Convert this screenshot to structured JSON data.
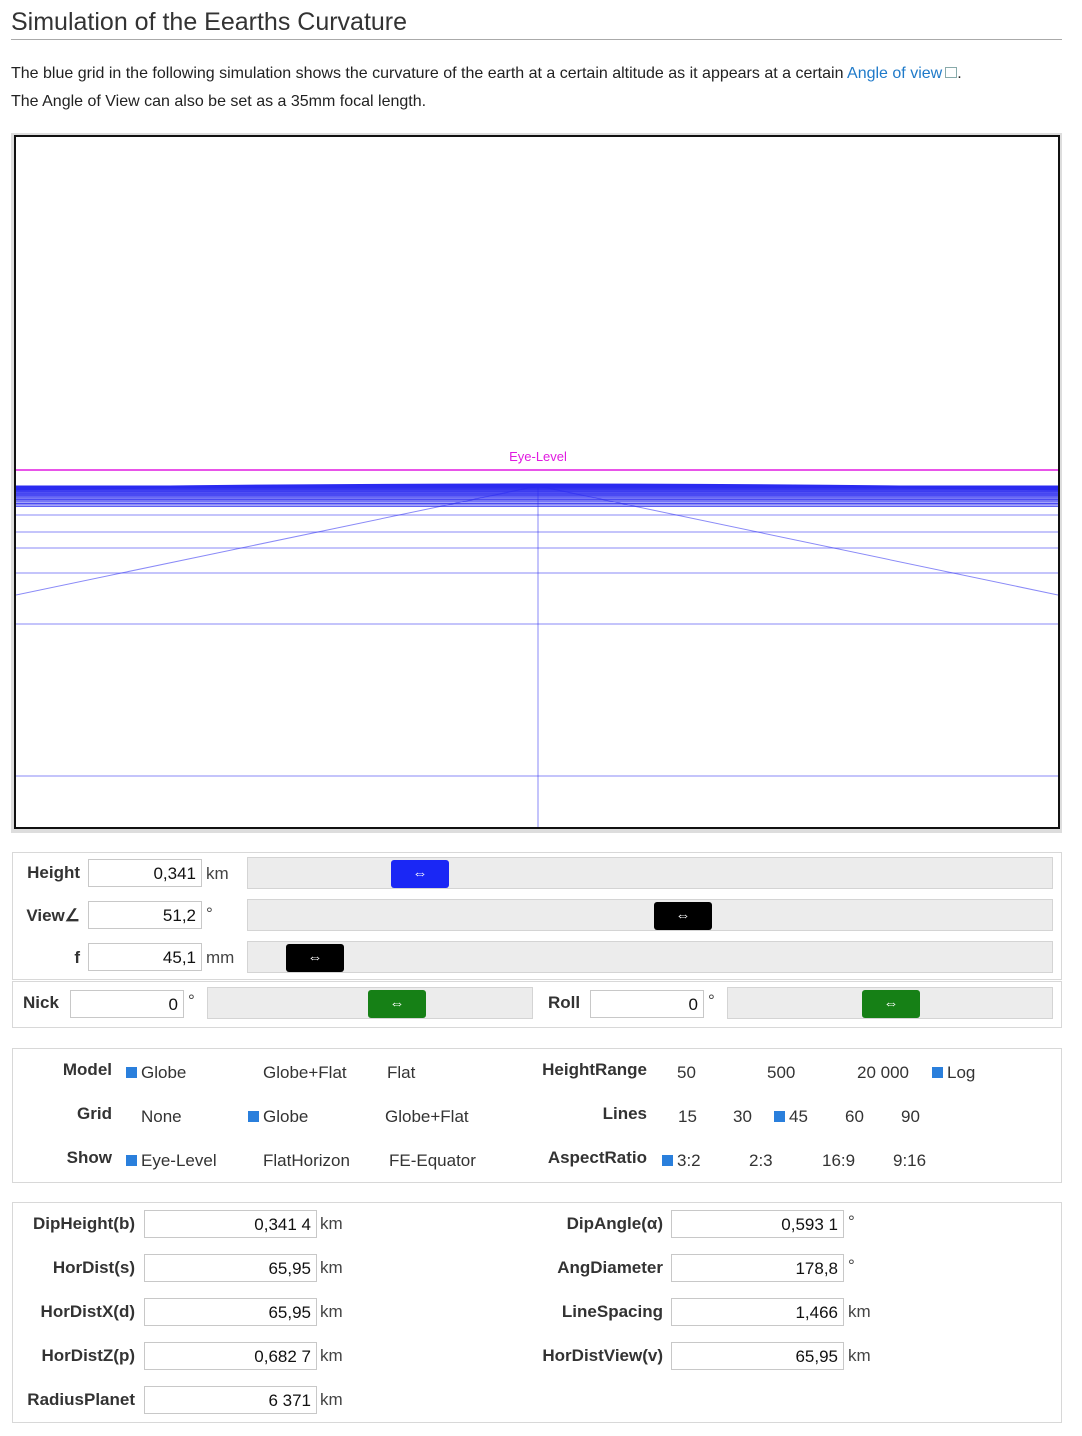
{
  "page": {
    "title": "Simulation of the Eearths Curvature",
    "intro_1": "The blue grid in the following simulation shows the curvature of the earth at a certain altitude as it appears at a certain ",
    "intro_link": "Angle of view",
    "intro_1_end": ".",
    "intro_2": "The Angle of View can also be set as a 35mm focal length."
  },
  "simulation": {
    "eye_level_label": "Eye-Level",
    "eye_level_color": "#e01be0",
    "grid_color": "#2a2af0"
  },
  "controls": {
    "height": {
      "label": "Height",
      "value": "0,341",
      "unit": "km",
      "knob": "⇔",
      "knob_color": "#1a27f5",
      "level": 0.17
    },
    "view": {
      "label": "View∠",
      "value": "51,2",
      "unit": "°",
      "knob": "⇔",
      "knob_color": "#000000",
      "level": 0.52
    },
    "f": {
      "label": "f",
      "value": "45,1",
      "unit": "mm",
      "knob": "⇔",
      "knob_color": "#000000",
      "level": 0.05
    },
    "nick": {
      "label": "Nick",
      "value": "0",
      "unit": "°",
      "knob": "⇔",
      "knob_color": "#168016",
      "level": 0.5
    },
    "roll": {
      "label": "Roll",
      "value": "0",
      "unit": "°",
      "knob": "⇔",
      "knob_color": "#168016",
      "level": 0.5
    }
  },
  "options": {
    "model": {
      "label": "Model",
      "items": [
        {
          "text": "Globe",
          "checked": true
        },
        {
          "text": "Globe+Flat",
          "checked": false
        },
        {
          "text": "Flat",
          "checked": false
        }
      ]
    },
    "grid": {
      "label": "Grid",
      "items": [
        {
          "text": "None",
          "checked": false
        },
        {
          "text": "Globe",
          "checked": true
        },
        {
          "text": "Globe+Flat",
          "checked": false
        }
      ]
    },
    "show": {
      "label": "Show",
      "items": [
        {
          "text": "Eye-Level",
          "checked": true
        },
        {
          "text": "FlatHorizon",
          "checked": false
        },
        {
          "text": "FE-Equator",
          "checked": false
        }
      ]
    },
    "heightrange": {
      "label": "HeightRange",
      "items": [
        {
          "text": "50",
          "checked": false
        },
        {
          "text": "500",
          "checked": false
        },
        {
          "text": "20 000",
          "checked": false
        },
        {
          "text": "Log",
          "checked": true
        }
      ]
    },
    "lines": {
      "label": "Lines",
      "items": [
        {
          "text": "15",
          "checked": false
        },
        {
          "text": "30",
          "checked": false
        },
        {
          "text": "45",
          "checked": true
        },
        {
          "text": "60",
          "checked": false
        },
        {
          "text": "90",
          "checked": false
        }
      ]
    },
    "aspect": {
      "label": "AspectRatio",
      "items": [
        {
          "text": "3:2",
          "checked": true
        },
        {
          "text": "2:3",
          "checked": false
        },
        {
          "text": "16:9",
          "checked": false
        },
        {
          "text": "9:16",
          "checked": false
        }
      ]
    }
  },
  "results": {
    "dip_height": {
      "label": "DipHeight(b)",
      "value": "0,341 4",
      "unit": "km"
    },
    "hor_dist": {
      "label": "HorDist(s)",
      "value": "65,95",
      "unit": "km"
    },
    "hor_dist_x": {
      "label": "HorDistX(d)",
      "value": "65,95",
      "unit": "km"
    },
    "hor_dist_z": {
      "label": "HorDistZ(p)",
      "value": "0,682 7",
      "unit": "km"
    },
    "radius_planet": {
      "label": "RadiusPlanet",
      "value": "6 371",
      "unit": "km"
    },
    "dip_angle": {
      "label": "DipAngle(α)",
      "value": "0,593 1",
      "unit": "°"
    },
    "ang_diameter": {
      "label": "AngDiameter",
      "value": "178,8",
      "unit": "°"
    },
    "line_spacing": {
      "label": "LineSpacing",
      "value": "1,466",
      "unit": "km"
    },
    "hor_dist_view": {
      "label": "HorDistView(v)",
      "value": "65,95",
      "unit": "km"
    }
  }
}
